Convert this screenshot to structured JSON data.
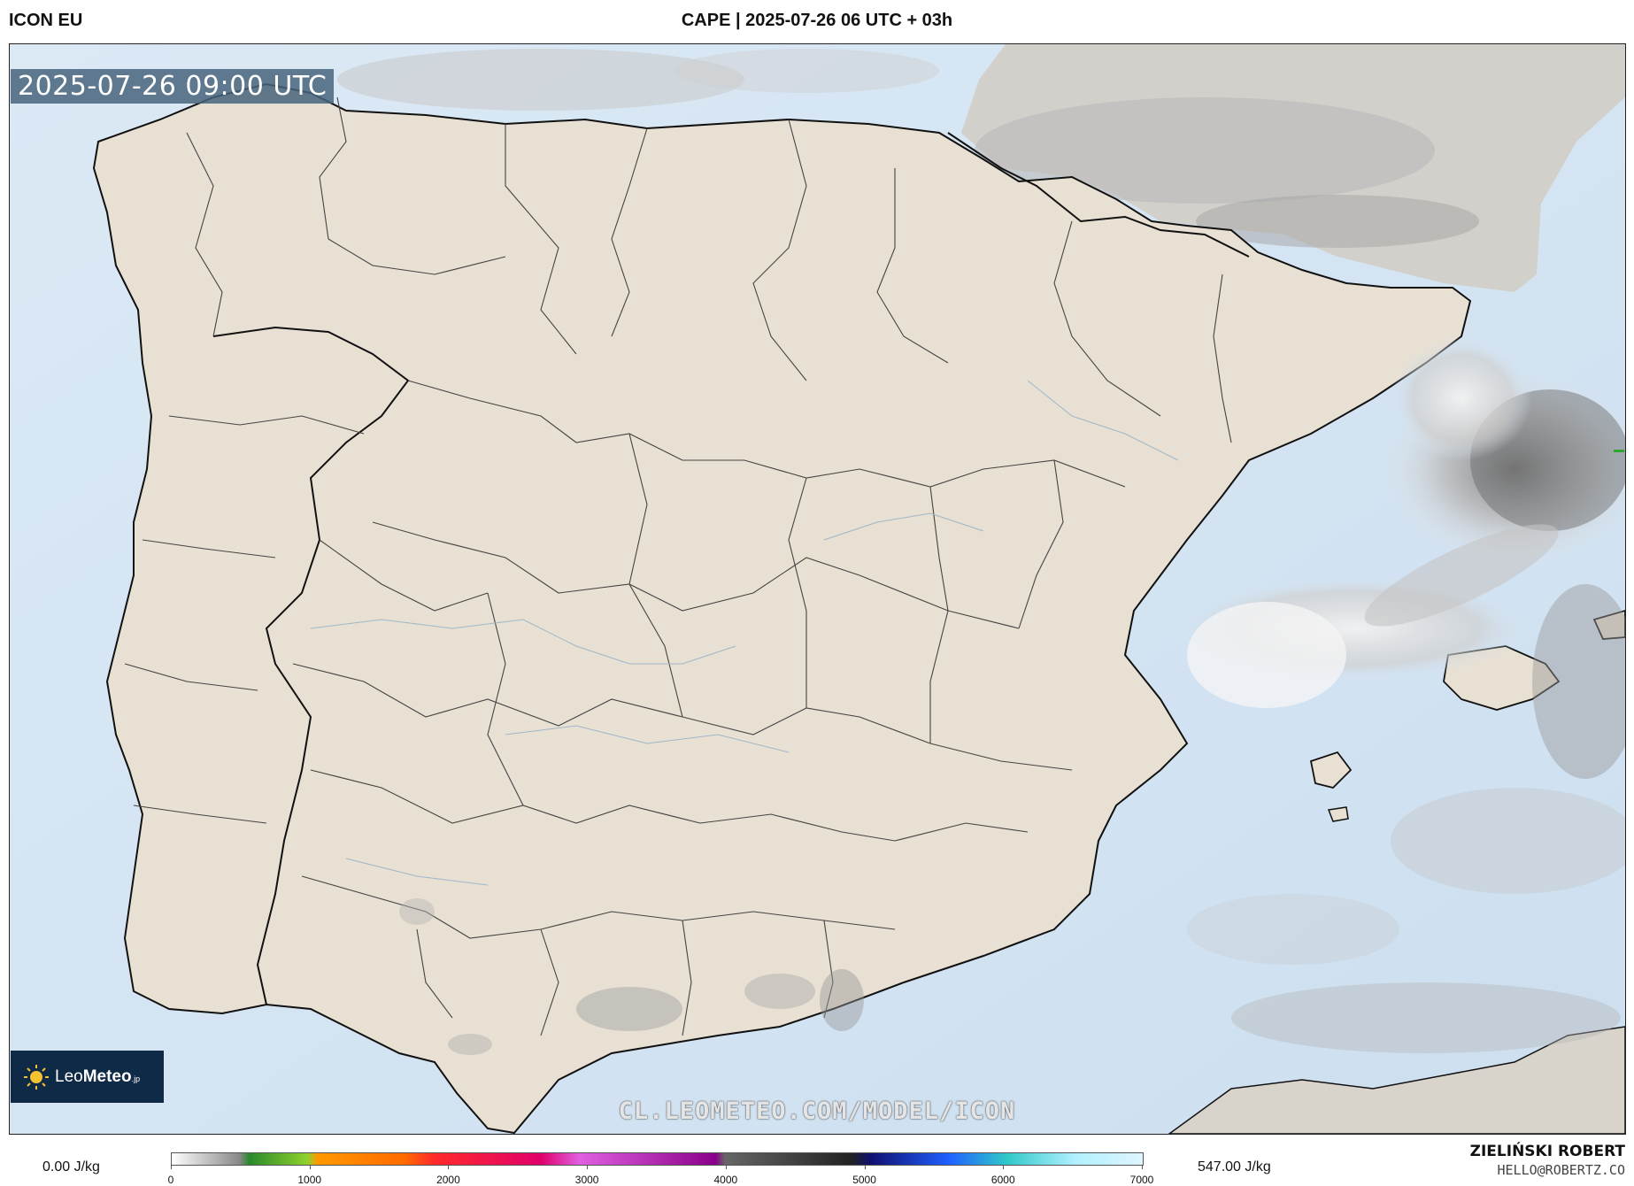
{
  "header": {
    "model": "ICON EU",
    "title": "CAPE | 2025-07-26 06 UTC + 03h"
  },
  "map": {
    "valid_time": "2025-07-26 09:00 UTC",
    "watermark": "CL.LEOMETEO.COM/MODEL/ICON",
    "logo": {
      "prefix": "Leo",
      "brand": "Meteo",
      "suffix": ".jp"
    },
    "colors": {
      "sea": "#d9e8f4",
      "land": "#e8e0d2",
      "border": "#111111"
    }
  },
  "legend": {
    "min_label": "0.00 J/kg",
    "max_label": "547.00 J/kg",
    "ticks": [
      "0",
      "1000",
      "2000",
      "3000",
      "4000",
      "5000",
      "6000",
      "7000"
    ]
  },
  "author": {
    "name": "ZIELIŃSKI ROBERT",
    "email": "HELLO@ROBERTZ.CO"
  }
}
